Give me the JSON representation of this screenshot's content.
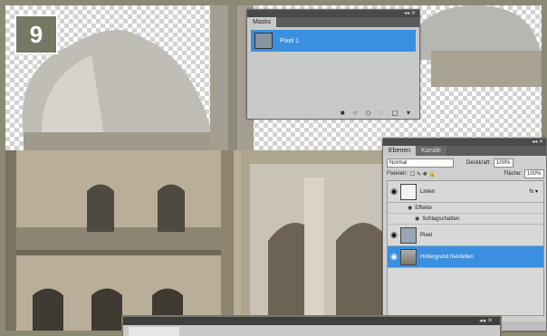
{
  "step": {
    "number": "9"
  },
  "masks_panel": {
    "title": "Masks",
    "controls": "◂◂ ✕",
    "mask_item": {
      "label": "Pixel 1"
    },
    "footer_icons": [
      "■",
      "○",
      "◇",
      "◌",
      "▢",
      "▾"
    ]
  },
  "layers_panel": {
    "controls": "◂◂ ✕",
    "tabs": [
      "Ebenen",
      "Kanäle"
    ],
    "blend_mode": "Normal",
    "opacity_label": "Deckkraft:",
    "opacity_value": "100%",
    "lock_label": "Fixieren:",
    "lock_icons": "☐ ✎ ✥ 🔒",
    "fill_label": "Fläche:",
    "fill_value": "100%",
    "layers": [
      {
        "name": "Linien",
        "fx": "fx ▾"
      },
      {
        "sub": "Effekte"
      },
      {
        "sub": "Schlagschatten"
      },
      {
        "name": "Pixel"
      },
      {
        "name": "Hintergrund freistellen"
      }
    ]
  },
  "bottom_panel": {
    "controls": "◂◂ ✕"
  },
  "colors": {
    "selection": "#3a8fe0",
    "panel_bg": "#c9c9c9",
    "frame": "#8c8a74"
  }
}
